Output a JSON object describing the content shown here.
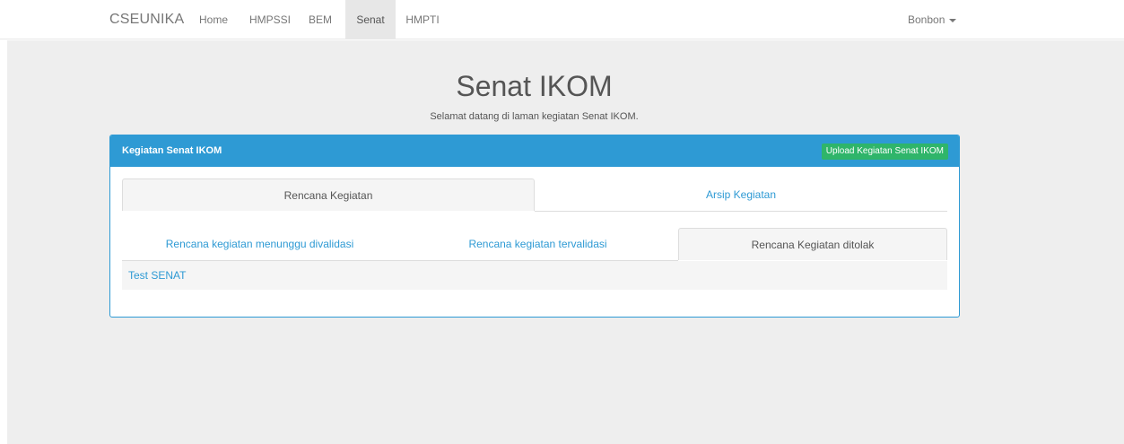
{
  "navbar": {
    "brand": "CSEUNIKA",
    "items": [
      {
        "label": "Home"
      },
      {
        "label": "HMPSSI"
      },
      {
        "label": "BEM"
      },
      {
        "label": "Senat"
      },
      {
        "label": "HMPTI"
      }
    ],
    "active_item": "Senat",
    "user": "Bonbon"
  },
  "page": {
    "title": "Senat IKOM",
    "subtitle": "Selamat datang di laman kegiatan Senat IKOM."
  },
  "panel": {
    "title": "Kegiatan Senat IKOM",
    "upload_label": "Upload Kegiatan Senat IKOM",
    "main_tabs": [
      {
        "label": "Rencana Kegiatan"
      },
      {
        "label": "Arsip Kegiatan"
      }
    ],
    "sub_tabs": [
      {
        "label": "Rencana kegiatan menunggu divalidasi"
      },
      {
        "label": "Rencana kegiatan tervalidasi"
      },
      {
        "label": "Rencana Kegiatan ditolak"
      }
    ],
    "items": [
      {
        "label": "Test SENAT"
      }
    ]
  },
  "colors": {
    "primary": "#2e9ad4",
    "success": "#2fb56a",
    "background": "#eeeeee"
  }
}
